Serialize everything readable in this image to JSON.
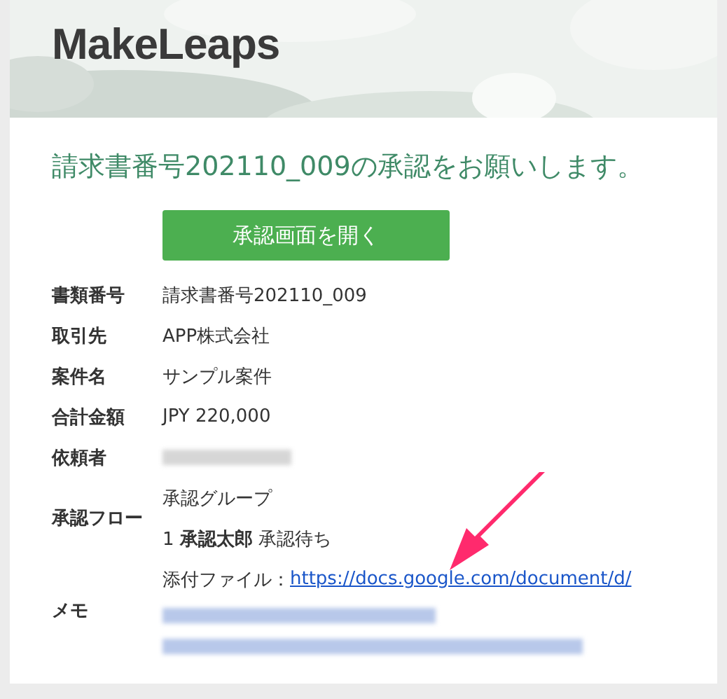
{
  "header": {
    "logo": "MakeLeaps"
  },
  "title": "請求書番号202110_009の承認をお願いします。",
  "button": "承認画面を開く",
  "details": [
    {
      "label": "書類番号",
      "kind": "text",
      "value": "請求書番号202110_009"
    },
    {
      "label": "取引先",
      "kind": "text",
      "value": "APP株式会社"
    },
    {
      "label": "案件名",
      "kind": "text",
      "value": "サンプル案件"
    },
    {
      "label": "合計金額",
      "kind": "text",
      "value": "JPY 220,000"
    },
    {
      "label": "依頼者",
      "kind": "redacted"
    },
    {
      "label": "承認フロー",
      "kind": "flow",
      "value": "承認グループ",
      "step": "1 **承認太郎** 承認待ち"
    },
    {
      "label": "メモ",
      "kind": "memo",
      "prefix": "添付ファイル：",
      "link": "https://docs.google.com/document/d/"
    }
  ]
}
